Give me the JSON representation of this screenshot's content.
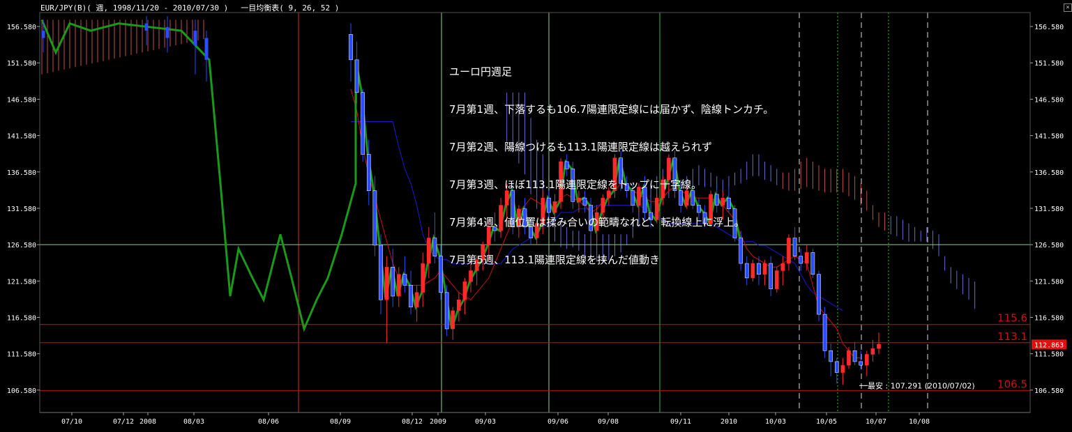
{
  "header": {
    "symbol": "EUR/JPY(B)( 週, 1998/11/20 - 2010/07/30 )",
    "indicator": "一目均衡表( 9, 26, 52 )"
  },
  "annotation": {
    "lines": [
      "ユーロ円週足",
      "7月第1週、下落するも106.7陽連限定線には届かず、陰線トンカチ。",
      "7月第2週、陽線つけるも113.1陽連限定線は越えられず",
      "7月第3週、ほぼ113.1陽連限定線をトップに十字線。",
      "7月第4週、値位置は揉み合いの範疇なれど、転換線上に浮上。",
      "7月第5週、113.1陽連限定線を挟んだ値動き"
    ]
  },
  "colors": {
    "background": "#000000",
    "up_candle": "#ff2a2a",
    "down_candle": "#2a4dff",
    "chikou": "#1a9a1a",
    "tenkan": "#d01010",
    "kijun": "#1a1ad0",
    "kumo_bull": "#c05050",
    "kumo_bear": "#6a6ad8",
    "hline_red": "#d01010",
    "hline_green": "#8fd08f",
    "price_tag_bg": "#e01010"
  },
  "chart_data": {
    "type": "candlestick",
    "title": "EUR/JPY(B)( 週, 1998/11/20 - 2010/07/30 )",
    "ylim": [
      103.5,
      158.5
    ],
    "y_ticks": [
      156.58,
      151.58,
      146.58,
      141.58,
      136.58,
      131.58,
      126.58,
      121.58,
      116.58,
      111.58,
      106.58
    ],
    "y_tick_labels": [
      "156.580",
      "151.580",
      "146.580",
      "141.580",
      "136.580",
      "131.580",
      "126.580",
      "121.580",
      "116.580",
      "111.580",
      "106.580"
    ],
    "x_tick_labels": [
      "07/10",
      "07/12",
      "2008",
      "08/03",
      "08/06",
      "08/09",
      "08/12",
      "2009",
      "09/03",
      "09/06",
      "09/08",
      "09/11",
      "2010",
      "10/03",
      "10/05",
      "10/07",
      "10/08"
    ],
    "current_price": "112.863",
    "horizontal_lines": [
      {
        "value": 115.6,
        "label": "115.6",
        "color": "red"
      },
      {
        "value": 113.1,
        "label": "113.1",
        "color": "red"
      },
      {
        "value": 106.5,
        "label": "106.5",
        "color": "red"
      },
      {
        "value": 126.58,
        "label": "",
        "color": "green"
      }
    ],
    "low_annotation": "最安 : 107.291 (2010/07/02)",
    "candles_2008_2010": [
      [
        155.5,
        157,
        149,
        152
      ],
      [
        152,
        154.5,
        146,
        147.5
      ],
      [
        147.5,
        148,
        138,
        139
      ],
      [
        139,
        141,
        132,
        134
      ],
      [
        134,
        136,
        125,
        126.5
      ],
      [
        126.5,
        128,
        117,
        119
      ],
      [
        119,
        125,
        113,
        123.5
      ],
      [
        123.5,
        126,
        118,
        119.5
      ],
      [
        119.5,
        123.5,
        118,
        122.5
      ],
      [
        122.5,
        125,
        120,
        121
      ],
      [
        121,
        123,
        117,
        118
      ],
      [
        118,
        121,
        116,
        120
      ],
      [
        120,
        125.5,
        118,
        124
      ],
      [
        124,
        129,
        122,
        127.5
      ],
      [
        127.5,
        131,
        124,
        125
      ],
      [
        125,
        126.5,
        119,
        120
      ],
      [
        120,
        121,
        114,
        115
      ],
      [
        115,
        118,
        113.5,
        117.5
      ],
      [
        117.5,
        120,
        116,
        119
      ],
      [
        119,
        122,
        117,
        121.5
      ],
      [
        121.5,
        124,
        120,
        123
      ],
      [
        123,
        125,
        121,
        124.5
      ],
      [
        124.5,
        127,
        123,
        126.5
      ],
      [
        126.5,
        130,
        124.5,
        129
      ],
      [
        129,
        131,
        127,
        128.5
      ],
      [
        128.5,
        133,
        127.5,
        132
      ],
      [
        132,
        135,
        130,
        134
      ],
      [
        134,
        135,
        128,
        129
      ],
      [
        129,
        132,
        127.5,
        131.5
      ],
      [
        131.5,
        133,
        128,
        129
      ],
      [
        129,
        130,
        126.5,
        127.5
      ],
      [
        127.5,
        130,
        126.5,
        129.5
      ],
      [
        129.5,
        134,
        128,
        133
      ],
      [
        133,
        134,
        130,
        131
      ],
      [
        131,
        133.5,
        129.5,
        132.5
      ],
      [
        132.5,
        138.5,
        131.5,
        138
      ],
      [
        138,
        139,
        136,
        137
      ],
      [
        137,
        138,
        131.5,
        132.5
      ],
      [
        132.5,
        134,
        131,
        133
      ],
      [
        133,
        134,
        131,
        132
      ],
      [
        132,
        133,
        128,
        128.5
      ],
      [
        128.5,
        132,
        127,
        131
      ],
      [
        131,
        133.5,
        130,
        133
      ],
      [
        133,
        134.5,
        132,
        134
      ],
      [
        134,
        139,
        133,
        138.5
      ],
      [
        138.5,
        139.5,
        134,
        135
      ],
      [
        135,
        136,
        133,
        134
      ],
      [
        134,
        135,
        131,
        132
      ],
      [
        132,
        135,
        131,
        134.5
      ],
      [
        134.5,
        136,
        130,
        131
      ],
      [
        131,
        133,
        129,
        130
      ],
      [
        130,
        133.5,
        129.5,
        133
      ],
      [
        133,
        136,
        132,
        135.5
      ],
      [
        135.5,
        139,
        134,
        138.5
      ],
      [
        138.5,
        139.5,
        133,
        134
      ],
      [
        134,
        135,
        131,
        132
      ],
      [
        132,
        134.5,
        131.5,
        134
      ],
      [
        134,
        135,
        131.5,
        132
      ],
      [
        132,
        133,
        130,
        131
      ],
      [
        131,
        132,
        129,
        129.5
      ],
      [
        129.5,
        134,
        129,
        133.5
      ],
      [
        133.5,
        135,
        131,
        132
      ],
      [
        132,
        134,
        130,
        133
      ],
      [
        133,
        134.5,
        131,
        131.5
      ],
      [
        131.5,
        132,
        127,
        127.5
      ],
      [
        127.5,
        128.5,
        123,
        124
      ],
      [
        124,
        125,
        121,
        122
      ],
      [
        122,
        124.5,
        121.5,
        124
      ],
      [
        124,
        125,
        121,
        122.5
      ],
      [
        122.5,
        124.5,
        121,
        124
      ],
      [
        124,
        125,
        119.5,
        120.5
      ],
      [
        120.5,
        123.5,
        120,
        123
      ],
      [
        123,
        125,
        121,
        124
      ],
      [
        124,
        128,
        123,
        127.5
      ],
      [
        127.5,
        129,
        124.5,
        125
      ],
      [
        125,
        126,
        123,
        124
      ],
      [
        124,
        126.5,
        123,
        125.5
      ],
      [
        125.5,
        126,
        122,
        122.5
      ],
      [
        122.5,
        123,
        116,
        117
      ],
      [
        117,
        118,
        111,
        112
      ],
      [
        112,
        113,
        108.5,
        110.5
      ],
      [
        110.5,
        111,
        107.5,
        109
      ],
      [
        109,
        111,
        107.3,
        110
      ],
      [
        110,
        112.5,
        109.5,
        112
      ],
      [
        112,
        113.2,
        110,
        110.5
      ],
      [
        110.5,
        112,
        109.5,
        110
      ],
      [
        110,
        112,
        108.5,
        111.5
      ],
      [
        111.5,
        113.5,
        110.5,
        112.3
      ],
      [
        112.3,
        114.5,
        111.5,
        112.9
      ]
    ],
    "tenkan": [
      148,
      145,
      140,
      136,
      133,
      130,
      127,
      124,
      122,
      121,
      121,
      121,
      121,
      121.5,
      122,
      123,
      122,
      121,
      120,
      119.5,
      119,
      120,
      121,
      122,
      124,
      126,
      128,
      130,
      131,
      132,
      133,
      132.5,
      132,
      131.5,
      132,
      133,
      133.5,
      133,
      132.5,
      132,
      131,
      131.5,
      132.5,
      133,
      134,
      135,
      135,
      134,
      133.5,
      133,
      132.5,
      132.5,
      133,
      134,
      134.5,
      134,
      133.5,
      133,
      133,
      133,
      133,
      132.5,
      132,
      131,
      130,
      128,
      126,
      125,
      124.5,
      124,
      123.5,
      123.5,
      124,
      124.5,
      125,
      124.5,
      124,
      121,
      118,
      117,
      116,
      115,
      113,
      112,
      111,
      111
    ],
    "kijun": [
      143.5,
      143.5,
      143.5,
      143.5,
      143.5,
      143.5,
      143.5,
      143.5,
      140,
      137,
      135,
      132,
      128,
      126,
      125,
      124.5,
      124.5,
      124,
      124,
      124,
      124,
      124,
      124,
      124,
      124,
      124,
      125,
      126,
      126.5,
      127,
      127.5,
      128.5,
      129,
      129.5,
      130,
      131,
      131,
      131,
      131.5,
      131.5,
      131.5,
      132,
      132,
      132,
      132,
      132,
      132,
      132,
      132,
      131.5,
      131,
      130.5,
      130,
      129.5,
      129.5,
      129.5,
      129.5,
      129.5,
      129.5,
      129.5,
      129.5,
      129,
      128.5,
      128,
      127.5,
      127,
      127,
      127,
      126.5,
      126.5,
      126,
      125.5,
      125,
      124.5,
      124,
      122.5,
      121,
      120,
      119.5,
      119,
      118.5,
      118,
      117.5
    ]
  }
}
